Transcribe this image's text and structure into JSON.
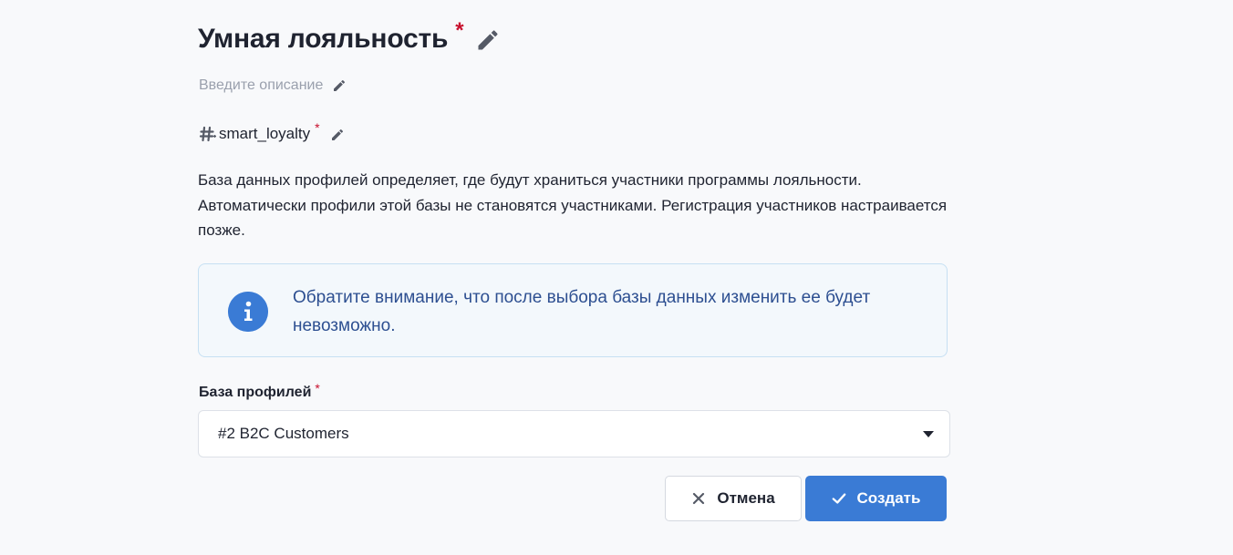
{
  "header": {
    "title": "Умная лояльность",
    "required_mark": "*",
    "edit_icon": "pencil-icon"
  },
  "description": {
    "placeholder": "Введите описание",
    "edit_icon": "pencil-icon"
  },
  "key": {
    "icon": "hash-icon",
    "value": "smart_loyalty",
    "required_mark": "*",
    "edit_icon": "pencil-icon"
  },
  "paragraph": {
    "text": "База данных профилей определяет, где будут храниться участники программы лояльности. Автоматически профили этой базы не становятся участниками. Регистрация участников настраивается позже."
  },
  "info": {
    "icon": "info-icon",
    "text": "Обратите внимание, что после выбора базы данных изменить ее будет невозможно."
  },
  "profile_base": {
    "label": "База профилей",
    "required_mark": "*",
    "selected": "#2 B2C Customers",
    "arrow_icon": "caret-down-icon"
  },
  "actions": {
    "cancel_label": "Отмена",
    "cancel_icon": "close-icon",
    "create_label": "Создать",
    "create_icon": "check-icon"
  },
  "colors": {
    "accent": "#3a7bd5",
    "required": "#c8102e",
    "info_background": "#f3f8fc",
    "info_border": "#c6e0f3",
    "info_text": "#2d4f91",
    "placeholder": "#9aa0ad"
  }
}
